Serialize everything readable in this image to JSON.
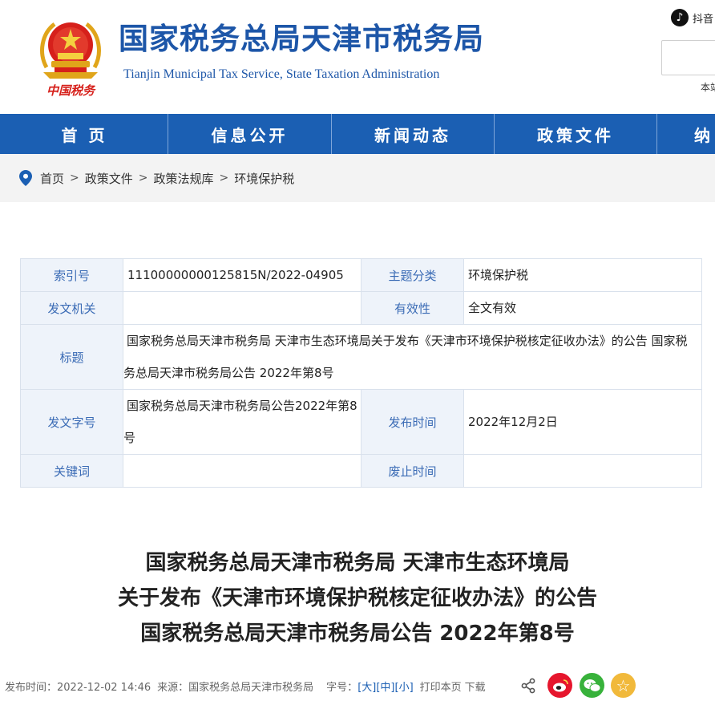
{
  "header": {
    "title": "国家税务总局天津市税务局",
    "subtitle": "Tianjin Municipal Tax Service, State Taxation Administration",
    "logo_text": "中国税务",
    "douyin_label": "抖音",
    "search_scope": "本站",
    "colors": {
      "brand": "#1d56a8",
      "emblem_red": "#d6201b",
      "emblem_gold": "#e6b422"
    }
  },
  "nav": {
    "items": [
      {
        "label": "首页"
      },
      {
        "label": "信息公开"
      },
      {
        "label": "新闻动态"
      },
      {
        "label": "政策文件"
      },
      {
        "label": "纳"
      }
    ],
    "color": "#1b5fb3"
  },
  "breadcrumb": {
    "icon": "location-pin-icon",
    "items": [
      "首页",
      "政策文件",
      "政策法规库",
      "环境保护税"
    ],
    "separator": ">"
  },
  "info_table": {
    "index_no_label": "索引号",
    "index_no": "11100000000125815N/2022-04905",
    "category_label": "主题分类",
    "category": "环境保护税",
    "issuer_label": "发文机关",
    "issuer": "",
    "validity_label": "有效性",
    "validity": "全文有效",
    "title_label": "标题",
    "title": "国家税务总局天津市税务局 天津市生态环境局关于发布《天津市环境保护税核定征收办法》的公告 国家税务总局天津市税务局公告 2022年第8号",
    "doc_no_label": "发文字号",
    "doc_no": "国家税务总局天津市税务局公告2022年第8号",
    "publish_label": "发布时间",
    "publish_date": "2022年12月2日",
    "keywords_label": "关键词",
    "keywords": "",
    "abolish_label": "废止时间",
    "abolish_date": ""
  },
  "article": {
    "title_lines": [
      "国家税务总局天津市税务局 天津市生态环境局",
      "关于发布《天津市环境保护税核定征收办法》的公告",
      "国家税务总局天津市税务局公告 2022年第8号"
    ]
  },
  "meta": {
    "publish_time": "发布时间：2022-12-02 14:46",
    "source": "来源：国家税务总局天津市税务局",
    "font_size_label": "字号：",
    "size_large": "[大]",
    "size_medium": "[中]",
    "size_small": "[小]",
    "print": "打印本页",
    "download": "下载"
  },
  "share": {
    "icons": [
      "share-icon",
      "weibo-icon",
      "wechat-icon",
      "favorite-icon"
    ],
    "colors": {
      "weibo": "#e6162d",
      "wechat": "#38b23b",
      "favorite": "#f1b93b"
    }
  }
}
